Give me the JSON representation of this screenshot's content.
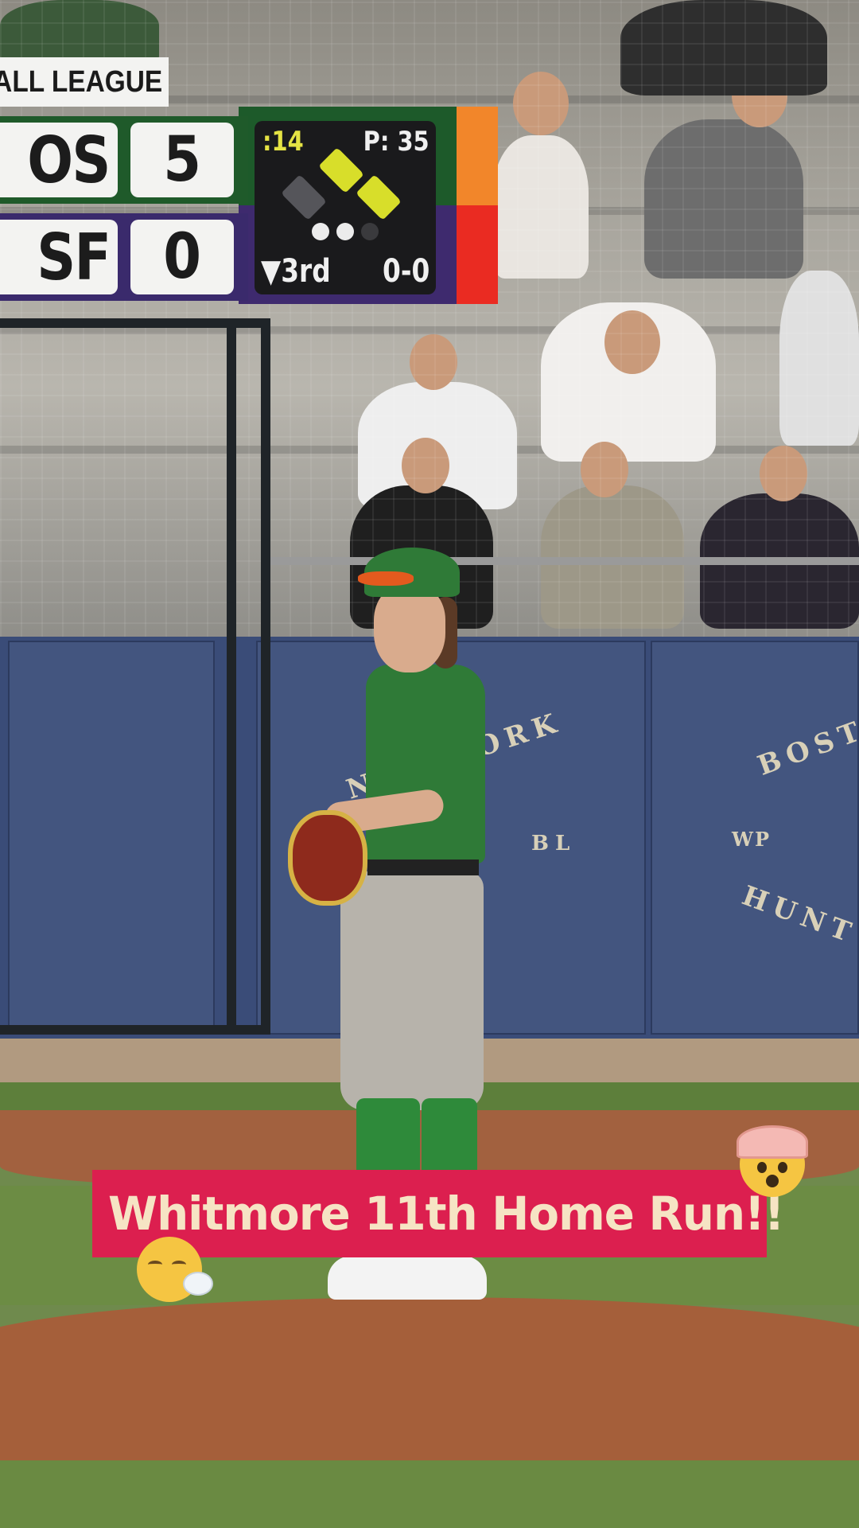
{
  "scoreboard": {
    "league": "SEBALL LEAGUE",
    "away": {
      "team": "OS",
      "score": "5",
      "color": "#1f5a2a"
    },
    "home": {
      "team": "SF",
      "score": "0",
      "color": "#3a2a6c"
    },
    "clock": ":14",
    "pitch_count": "P: 35",
    "inning": "▼3rd",
    "count": "0-0",
    "bases": {
      "first": true,
      "second": true,
      "third": false
    },
    "outs": 2,
    "accent_colors": [
      "#f2862a",
      "#ea2b22"
    ]
  },
  "caption": {
    "text": "Whitmore 11th Home Run!!",
    "background": "#dc1f4f",
    "emojis": [
      "exploding-head-emoji",
      "face-exhaling-emoji"
    ]
  },
  "scene": {
    "wall_text_left": "NEW YORK",
    "wall_text_mid": "BL",
    "wall_text_right_top": "BOST",
    "wall_text_right_wp": "WP",
    "wall_text_right_bottom": "HUNT"
  }
}
